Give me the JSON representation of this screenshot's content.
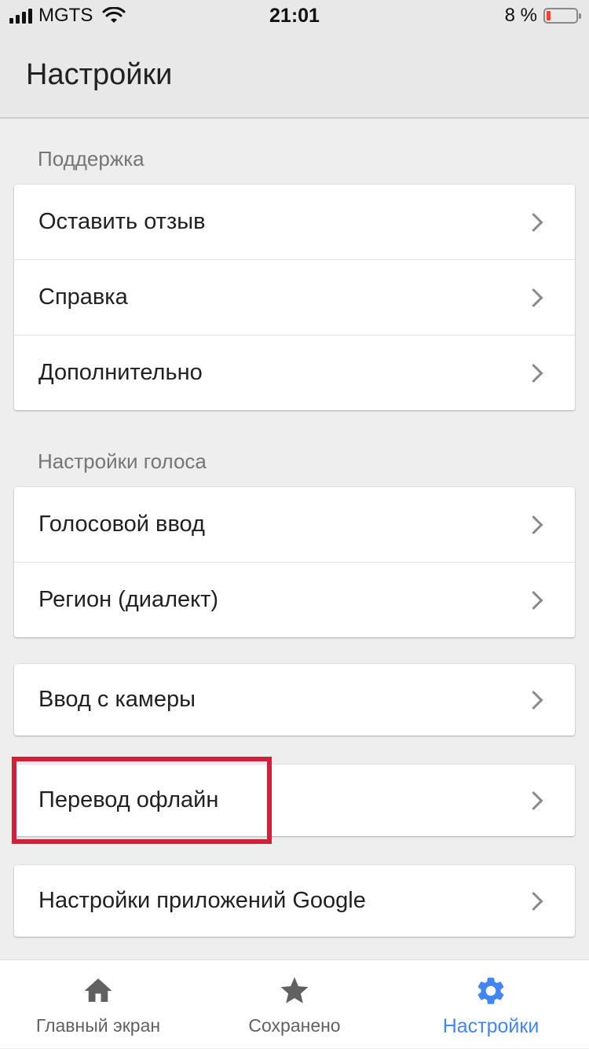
{
  "status_bar": {
    "carrier": "MGTS",
    "time": "21:01",
    "battery_percent": "8 %",
    "battery_level": 0.08,
    "battery_color": "#ff3b30"
  },
  "app_bar": {
    "title": "Настройки"
  },
  "sections": [
    {
      "label": "Поддержка",
      "items": [
        {
          "label": "Оставить отзыв"
        },
        {
          "label": "Справка"
        },
        {
          "label": "Дополнительно"
        }
      ]
    },
    {
      "label": "Настройки голоса",
      "items": [
        {
          "label": "Голосовой ввод"
        },
        {
          "label": "Регион (диалект)"
        }
      ]
    },
    {
      "label": "",
      "items": [
        {
          "label": "Ввод с камеры"
        }
      ]
    },
    {
      "label": "",
      "items": [
        {
          "label": "Перевод офлайн"
        }
      ]
    },
    {
      "label": "",
      "items": [
        {
          "label": "Настройки приложений Google"
        }
      ]
    }
  ],
  "highlighted_item": "Перевод офлайн",
  "highlight_color": "#d0203a",
  "bottom_nav": {
    "items": [
      {
        "label": "Главный экран",
        "icon": "home-icon",
        "active": false
      },
      {
        "label": "Сохранено",
        "icon": "star-icon",
        "active": false
      },
      {
        "label": "Настройки",
        "icon": "gear-icon",
        "active": true
      }
    ],
    "active_color": "#4285f4"
  }
}
